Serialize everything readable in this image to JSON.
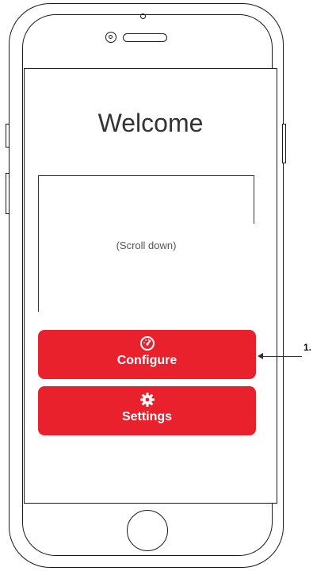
{
  "screen": {
    "title": "Welcome",
    "scroll_hint": "(Scroll down)"
  },
  "buttons": [
    {
      "label": "Configure",
      "icon": "speedometer-icon"
    },
    {
      "label": "Settings",
      "icon": "gear-icon"
    }
  ],
  "callout": {
    "label": "1."
  },
  "colors": {
    "accent": "#e8212c",
    "outline": "#1a1a1a"
  }
}
